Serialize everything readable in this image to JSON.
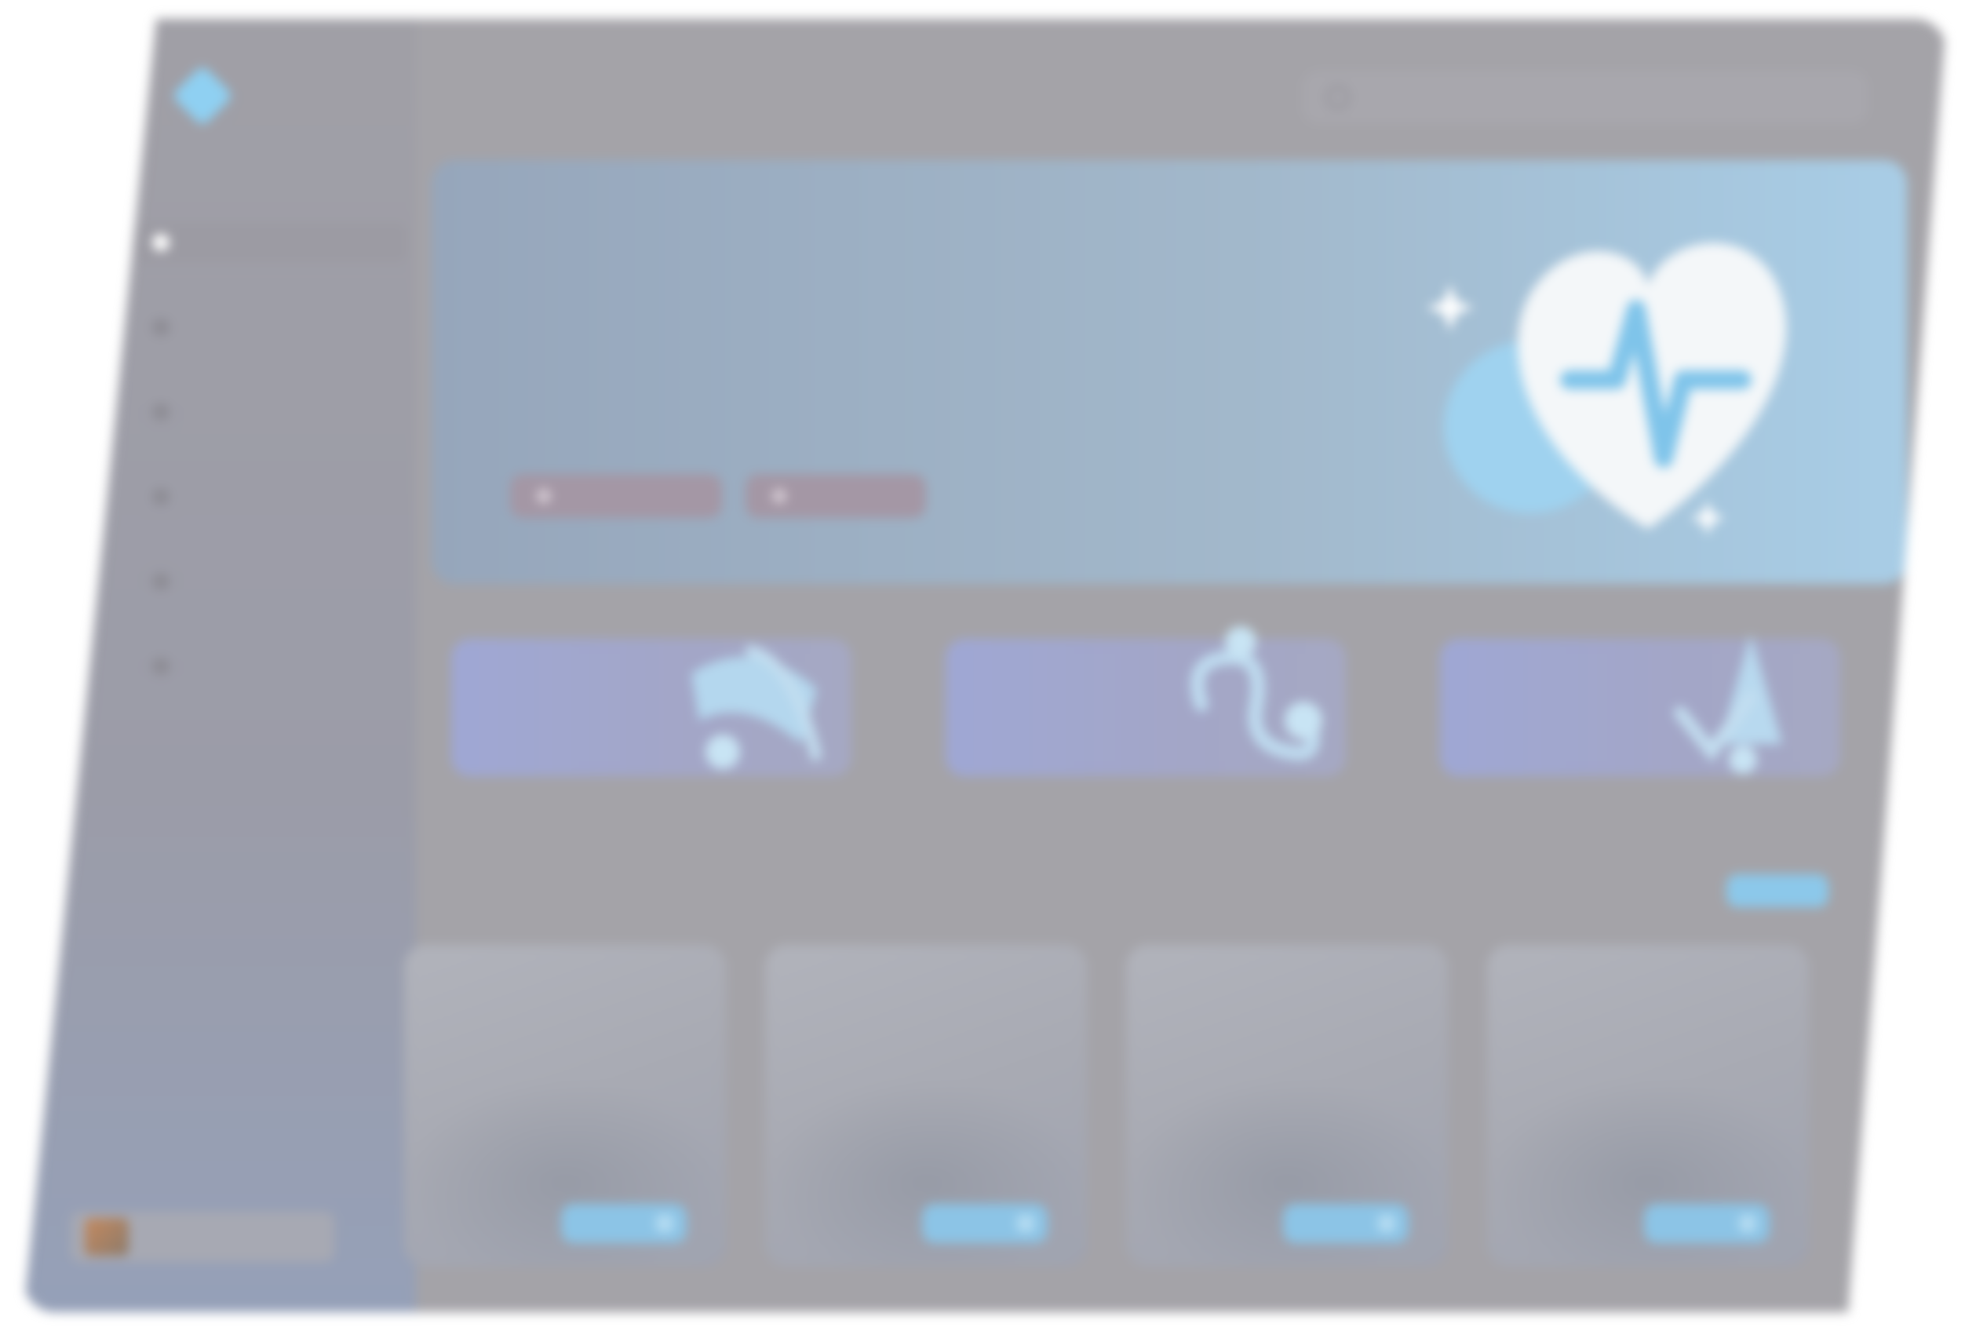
{
  "brand": {
    "name": "",
    "tagline": ""
  },
  "header": {
    "title": "",
    "subtitle": ""
  },
  "search": {
    "placeholder": ""
  },
  "sidebar": {
    "items": [
      {
        "label": "",
        "icon": "home-icon"
      },
      {
        "label": "",
        "icon": "grid-icon"
      },
      {
        "label": "",
        "icon": "calendar-icon"
      },
      {
        "label": "",
        "icon": "heart-icon"
      },
      {
        "label": "",
        "icon": "chat-icon"
      },
      {
        "label": "",
        "icon": "settings-icon"
      }
    ],
    "promo": {
      "text": ""
    }
  },
  "hero": {
    "title_before": "",
    "title_highlight": "",
    "title_after": "",
    "description": "",
    "primary_button": "",
    "secondary_button": "",
    "illustration": "heart-pulse-illustration"
  },
  "features": [
    {
      "title": "",
      "link": "",
      "icon": "stethoscope-illustration"
    },
    {
      "title": "",
      "link": "",
      "icon": "stethoscope-illustration"
    },
    {
      "title": "",
      "link": "",
      "icon": "flask-illustration"
    }
  ],
  "categories": {
    "title": "",
    "subtitle": "",
    "see_all": "",
    "items": [
      {
        "title": "",
        "description": "",
        "button": ""
      },
      {
        "title": "",
        "description": "",
        "button": ""
      },
      {
        "title": "",
        "description": "",
        "button": ""
      },
      {
        "title": "",
        "description": "",
        "button": ""
      }
    ]
  },
  "colors": {
    "accent": "#8cc8ea",
    "highlight": "#e0e789",
    "window": "#a4a3a8"
  }
}
